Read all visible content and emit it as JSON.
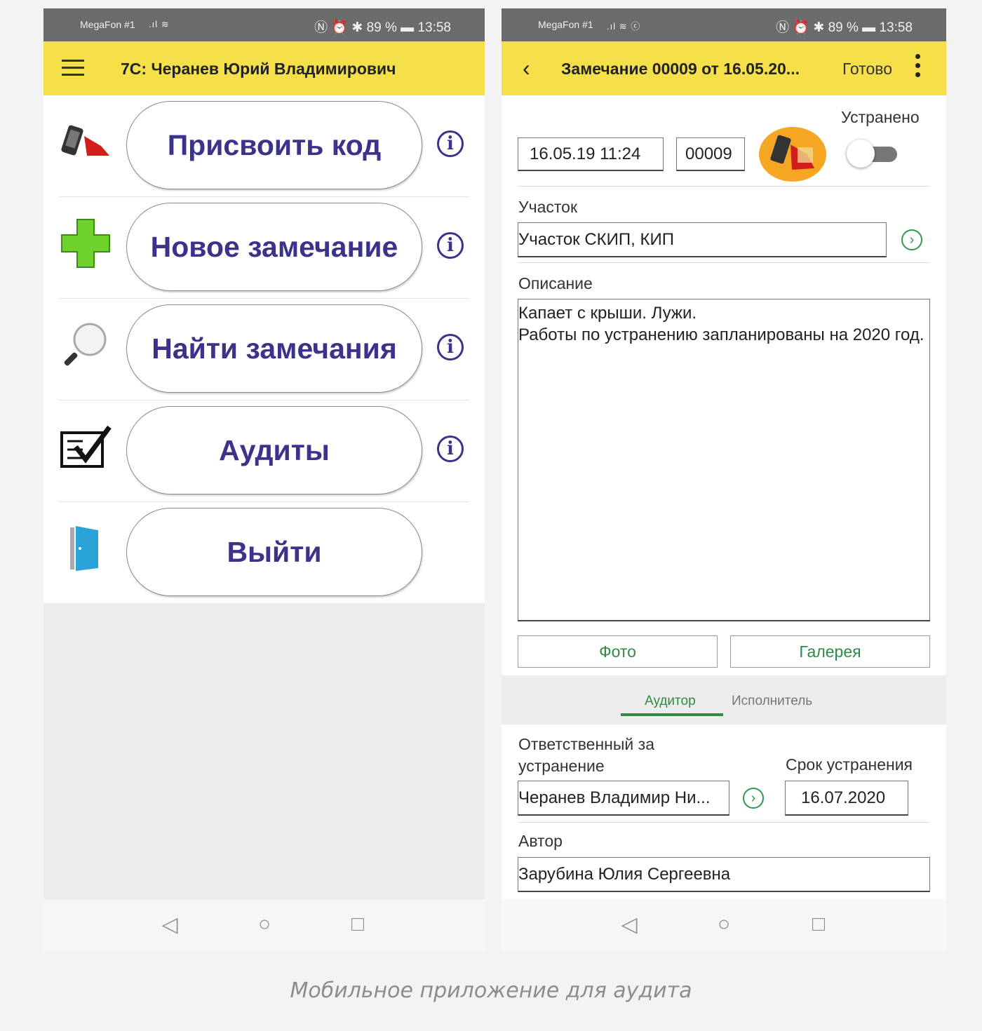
{
  "status_left": {
    "carrier": "MegaFon #1",
    "battery": "89 %",
    "time": "13:58"
  },
  "status_right": {
    "carrier": "MegaFon #1",
    "battery": "89 %",
    "time": "13:58"
  },
  "main_menu": {
    "title": "7С: Черанев Юрий Владимирович",
    "items": [
      {
        "label": "Присвоить код",
        "icon": "phone-nfc-icon"
      },
      {
        "label": "Новое замечание",
        "icon": "plus-icon"
      },
      {
        "label": "Найти замечания",
        "icon": "magnifier-icon"
      },
      {
        "label": "Аудиты",
        "icon": "checklist-icon"
      },
      {
        "label": "Выйти",
        "icon": "door-icon"
      }
    ]
  },
  "remark_form": {
    "title": "Замечание 00009 от 16.05.20...",
    "done_label": "Готово",
    "fixed_label": "Устранено",
    "date_value": "16.05.19 11:24",
    "number_value": "00009",
    "section_label": "Участок",
    "section_value": "Участок СКИП, КИП",
    "description_label": "Описание",
    "description_value": "Капает с крыши. Лужи.\nРаботы по устранению запланированы на 2020 год.",
    "photo_label": "Фото",
    "gallery_label": "Галерея",
    "tabs": [
      {
        "label": "Аудитор",
        "active": true
      },
      {
        "label": "Исполнитель",
        "active": false
      }
    ],
    "responsible_label": "Ответственный за устранение",
    "responsible_value": "Черанев Владимир Ни...",
    "deadline_label": "Срок устранения",
    "deadline_value": "16.07.2020",
    "author_label": "Автор",
    "author_value": "Зарубина Юлия Сергеевна"
  },
  "caption": "Мобильное приложение для аудита",
  "colors": {
    "appbar": "#f6e04a",
    "menu_text": "#3b3289",
    "accent_green": "#2e9a4b",
    "statusbar": "#6b6b6b"
  }
}
